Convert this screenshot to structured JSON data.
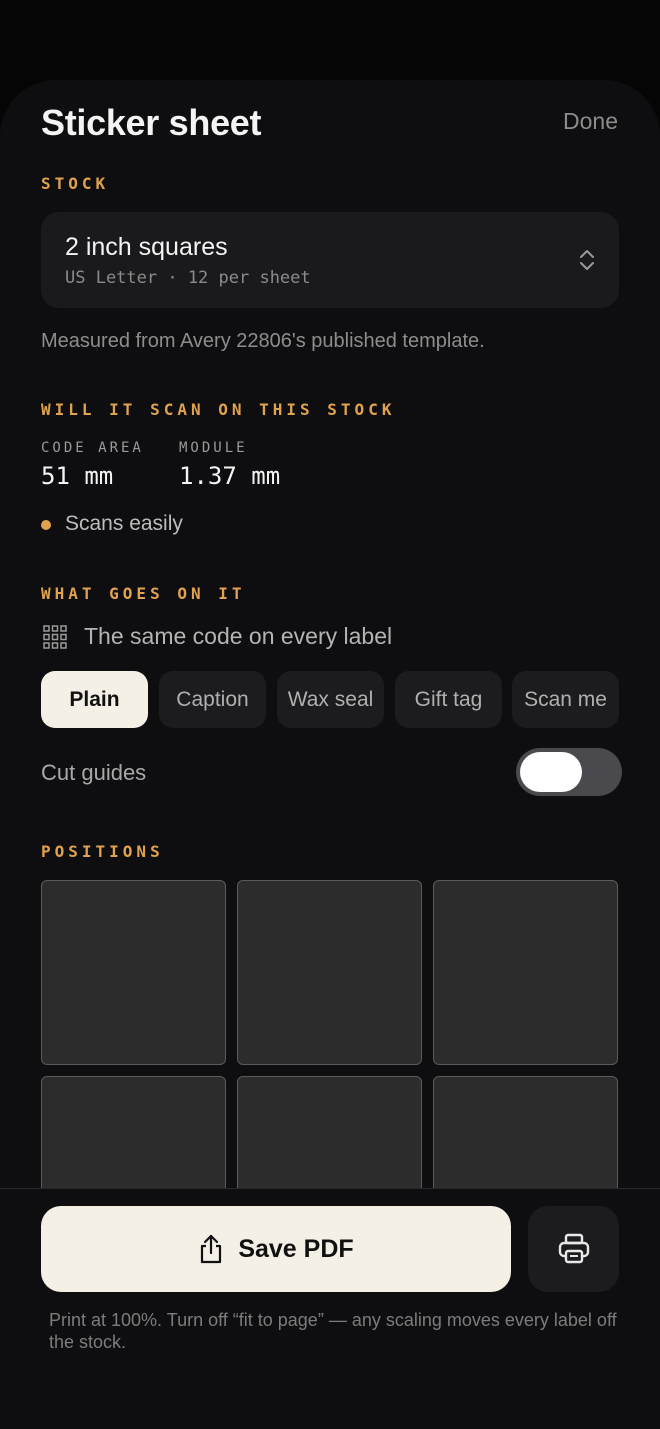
{
  "header": {
    "title": "Sticker sheet",
    "done_label": "Done"
  },
  "stock": {
    "section_label": "STOCK",
    "selected_name": "2 inch squares",
    "selected_detail": "US Letter · 12 per sheet",
    "note": "Measured from Avery 22806's published template."
  },
  "scan": {
    "section_label": "WILL IT SCAN ON THIS STOCK",
    "code_area_label": "CODE AREA",
    "code_area_value": "51 mm",
    "module_label": "MODULE",
    "module_value": "1.37 mm",
    "status_text": "Scans easily",
    "status_color": "#e0a24e"
  },
  "content": {
    "section_label": "WHAT GOES ON IT",
    "mode_text": "The same code on every label",
    "mode_icon": "grid-icon",
    "styles": [
      "Plain",
      "Caption",
      "Wax seal",
      "Gift tag",
      "Scan me"
    ],
    "selected_style": "Plain"
  },
  "cut_guides": {
    "label": "Cut guides",
    "enabled": false
  },
  "positions": {
    "section_label": "POSITIONS"
  },
  "actions": {
    "save_label": "Save PDF",
    "save_icon": "share-icon",
    "print_icon": "printer-icon",
    "footnote": "Print at 100%. Turn off “fit to page” — any scaling moves every label off the stock."
  },
  "colors": {
    "accent": "#e0a24e",
    "primary_button": "#f4f0e6",
    "background": "#0e0e10"
  }
}
